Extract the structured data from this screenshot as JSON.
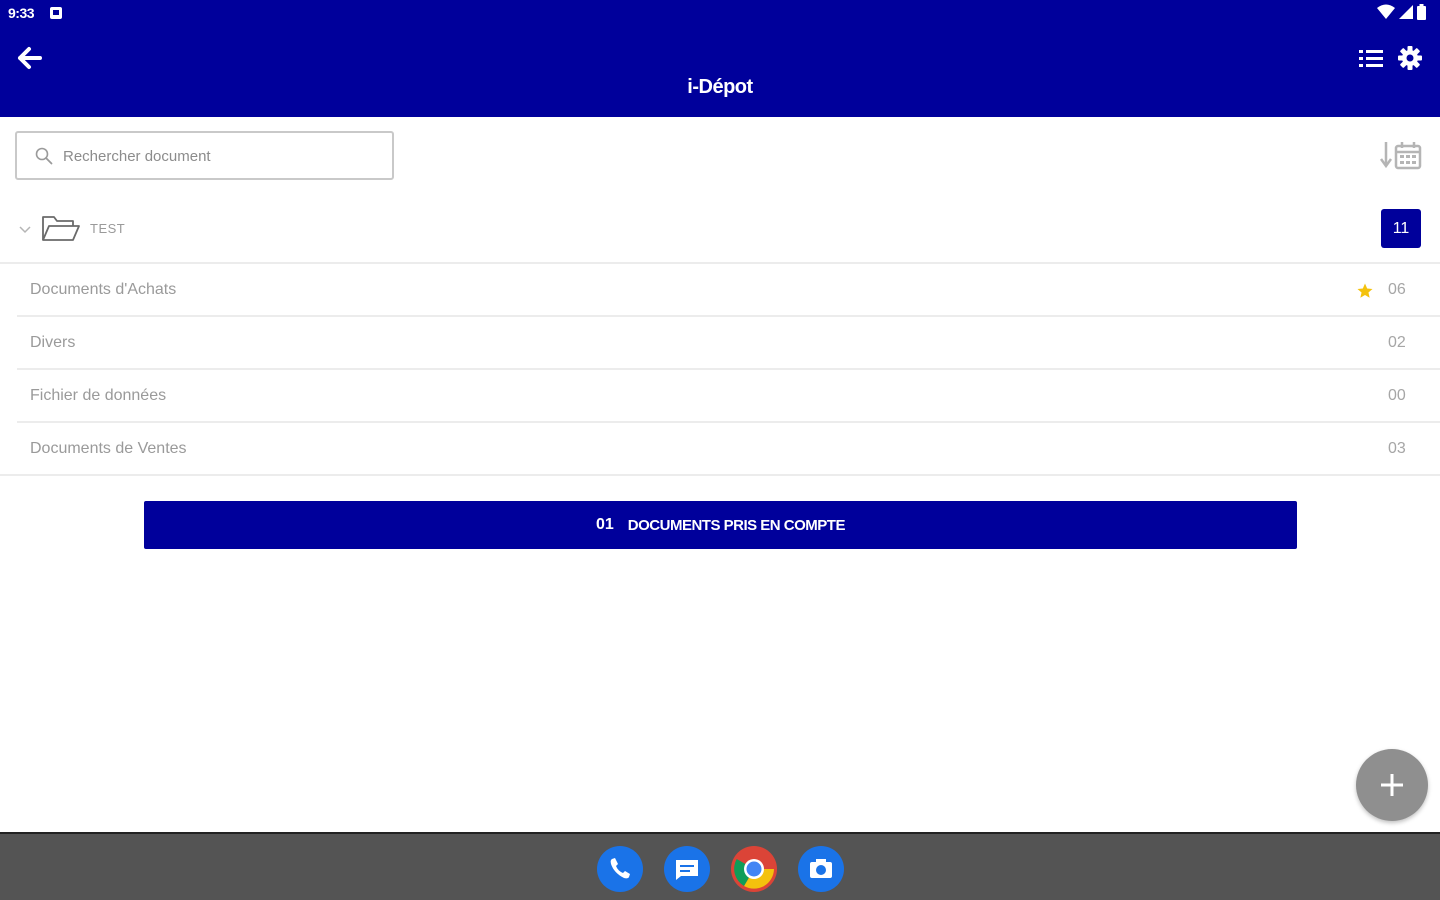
{
  "status_bar": {
    "time": "9:33"
  },
  "header": {
    "title": "i-Dépot",
    "background": "#00009b"
  },
  "search": {
    "placeholder": "Rechercher document"
  },
  "folder": {
    "name": "TEST",
    "count": "11"
  },
  "categories": [
    {
      "label": "Documents d'Achats",
      "count": "06",
      "starred": true
    },
    {
      "label": "Divers",
      "count": "02",
      "starred": false
    },
    {
      "label": "Fichier de données",
      "count": "00",
      "starred": false
    },
    {
      "label": "Documents de Ventes",
      "count": "03",
      "starred": false
    }
  ],
  "documents_button": {
    "count": "01",
    "label": "DOCUMENTS PRIS EN COMPTE"
  },
  "dock": {
    "apps": [
      "phone-icon",
      "messages-icon",
      "chrome-icon",
      "camera-icon"
    ]
  },
  "colors": {
    "primary": "#00009b",
    "star": "#f4c20d",
    "fab": "#8f8f8f",
    "dock": "#545454"
  }
}
